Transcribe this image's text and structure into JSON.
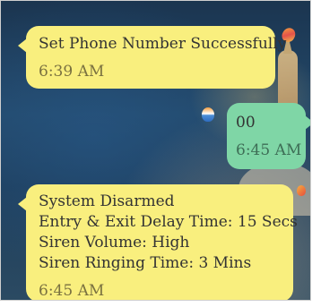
{
  "messages": [
    {
      "direction": "incoming",
      "lines": [
        "Set Phone Number Successfully"
      ],
      "time": "6:39 AM"
    },
    {
      "direction": "outgoing",
      "lines": [
        "00"
      ],
      "time": "6:45 AM"
    },
    {
      "direction": "incoming",
      "lines": [
        "System Disarmed",
        "Entry & Exit Delay Time: 15 Secs",
        "Siren Volume: High",
        "Siren Ringing Time: 3 Mins"
      ],
      "time": "6:45 AM"
    }
  ],
  "colors": {
    "incoming_bubble": "#f9ef7e",
    "outgoing_bubble": "#7fd6a6",
    "text": "#333333"
  },
  "icons": {
    "background": "hot-air-balloon-wallpaper",
    "balloons": [
      "hot-air-balloon-icon",
      "hot-air-balloon-icon",
      "hot-air-balloon-icon"
    ]
  }
}
